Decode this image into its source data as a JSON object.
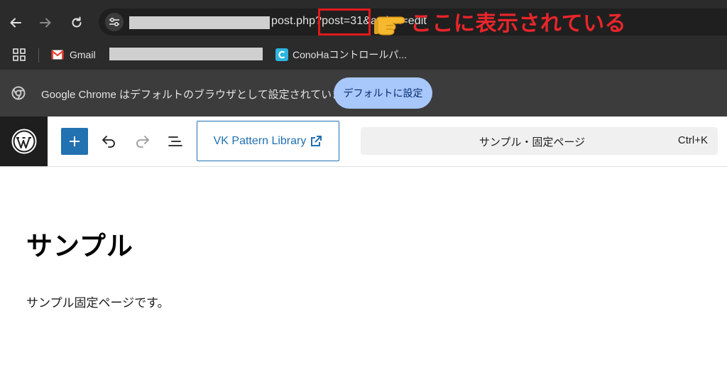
{
  "browser": {
    "url_visible": "post.php?post=31&action=edit",
    "callout": "ここに表示されている",
    "bookmarks": {
      "gmail": "Gmail",
      "conoha": "ConoHaコントロールパ..."
    },
    "infobar": {
      "message": "Google Chrome はデフォルトのブラウザとして設定されていません",
      "button": "デフォルトに設定"
    }
  },
  "editor": {
    "pattern_library_label": "VK Pattern Library",
    "command_bar_title": "サンプル・固定ページ",
    "command_bar_shortcut": "Ctrl+K",
    "accent_color": "#2271b1"
  },
  "content": {
    "title": "サンプル",
    "body": "サンプル固定ページです。"
  },
  "colors": {
    "annotation_red": "#e8262b",
    "chrome_toolbar": "#2b2b2b",
    "infobar_button": "#a8c7fa"
  }
}
